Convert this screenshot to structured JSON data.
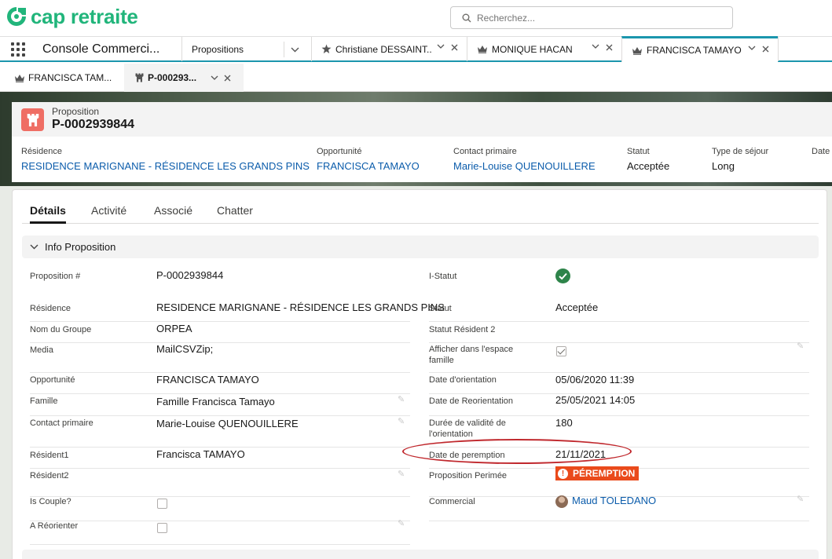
{
  "brand": {
    "name": "cap retraite",
    "color": "#21b57b"
  },
  "search": {
    "placeholder": "Recherchez..."
  },
  "nav": {
    "app_name": "Console Commerci...",
    "tabs": [
      {
        "label": "Propositions",
        "icon": "none"
      },
      {
        "label": "Christiane DESSAINT...",
        "icon": "star-person-icon"
      },
      {
        "label": "MONIQUE HACAN",
        "icon": "crown-icon"
      },
      {
        "label": "FRANCISCA TAMAYO",
        "icon": "crown-icon"
      }
    ]
  },
  "subtabs": [
    {
      "label": "FRANCISCA TAM...",
      "icon": "crown-icon"
    },
    {
      "label": "P-000293...",
      "icon": "tower-icon"
    }
  ],
  "record": {
    "type": "Proposition",
    "title": "P-0002939844",
    "header_fields": [
      {
        "label": "Résidence",
        "value": "RESIDENCE MARIGNANE - RÉSIDENCE LES GRANDS PINS",
        "link": true
      },
      {
        "label": "Opportunité",
        "value": "FRANCISCA TAMAYO",
        "link": true
      },
      {
        "label": "Contact primaire",
        "value": "Marie-Louise QUENOUILLERE",
        "link": true
      },
      {
        "label": "Statut",
        "value": "Acceptée",
        "link": false
      },
      {
        "label": "Type de séjour",
        "value": "Long",
        "link": false
      },
      {
        "label": "Date",
        "value": "",
        "link": false
      }
    ]
  },
  "detail_tabs": [
    "Détails",
    "Activité",
    "Associé",
    "Chatter"
  ],
  "section": {
    "title": "Info Proposition"
  },
  "left_fields": [
    {
      "label": "Proposition #",
      "value": "P-0002939844"
    },
    {
      "label": "Résidence",
      "value": "RESIDENCE MARIGNANE - RÉSIDENCE LES GRANDS PINS"
    },
    {
      "label": "Nom du Groupe",
      "value": "ORPEA"
    },
    {
      "label": "Media",
      "value": "MailCSVZip;"
    },
    {
      "label": "Opportunité",
      "value": "FRANCISCA TAMAYO"
    },
    {
      "label": "Famille",
      "value": "Famille Francisca Tamayo"
    },
    {
      "label": "Contact primaire",
      "value": "Marie-Louise QUENOUILLERE"
    },
    {
      "label": "Résident1",
      "value": "Francisca TAMAYO"
    },
    {
      "label": "Résident2",
      "value": ""
    },
    {
      "label": "Is Couple?",
      "value": ""
    },
    {
      "label": "A Réorienter",
      "value": ""
    }
  ],
  "right_fields": [
    {
      "label": "I-Statut",
      "value": ""
    },
    {
      "label": "Statut",
      "value": "Acceptée"
    },
    {
      "label": "Statut Résident 2",
      "value": ""
    },
    {
      "label_line1": "Afficher dans l'espace",
      "label_line2": "famille",
      "value": ""
    },
    {
      "label": "Date d'orientation",
      "value": "05/06/2020 11:39"
    },
    {
      "label": "Date de Reorientation",
      "value": "25/05/2021 14:05"
    },
    {
      "label_line1": "Durée de validité de",
      "label_line2": "l'orientation",
      "value": "180"
    },
    {
      "label": "Date de peremption",
      "value": "21/11/2021"
    },
    {
      "label": "Proposition Perimée",
      "value": "PÉREMPTION"
    },
    {
      "label": "Commercial",
      "value": "Maud TOLEDANO"
    }
  ],
  "checkboxes": {
    "afficher_famille": true,
    "is_couple": false,
    "a_reorienter": false
  },
  "colors": {
    "link": "#0b5cab",
    "success": "#2e844a",
    "warning_badge": "#ea4a1b",
    "accent": "#1b96ad",
    "annotation": "#c0282d"
  }
}
